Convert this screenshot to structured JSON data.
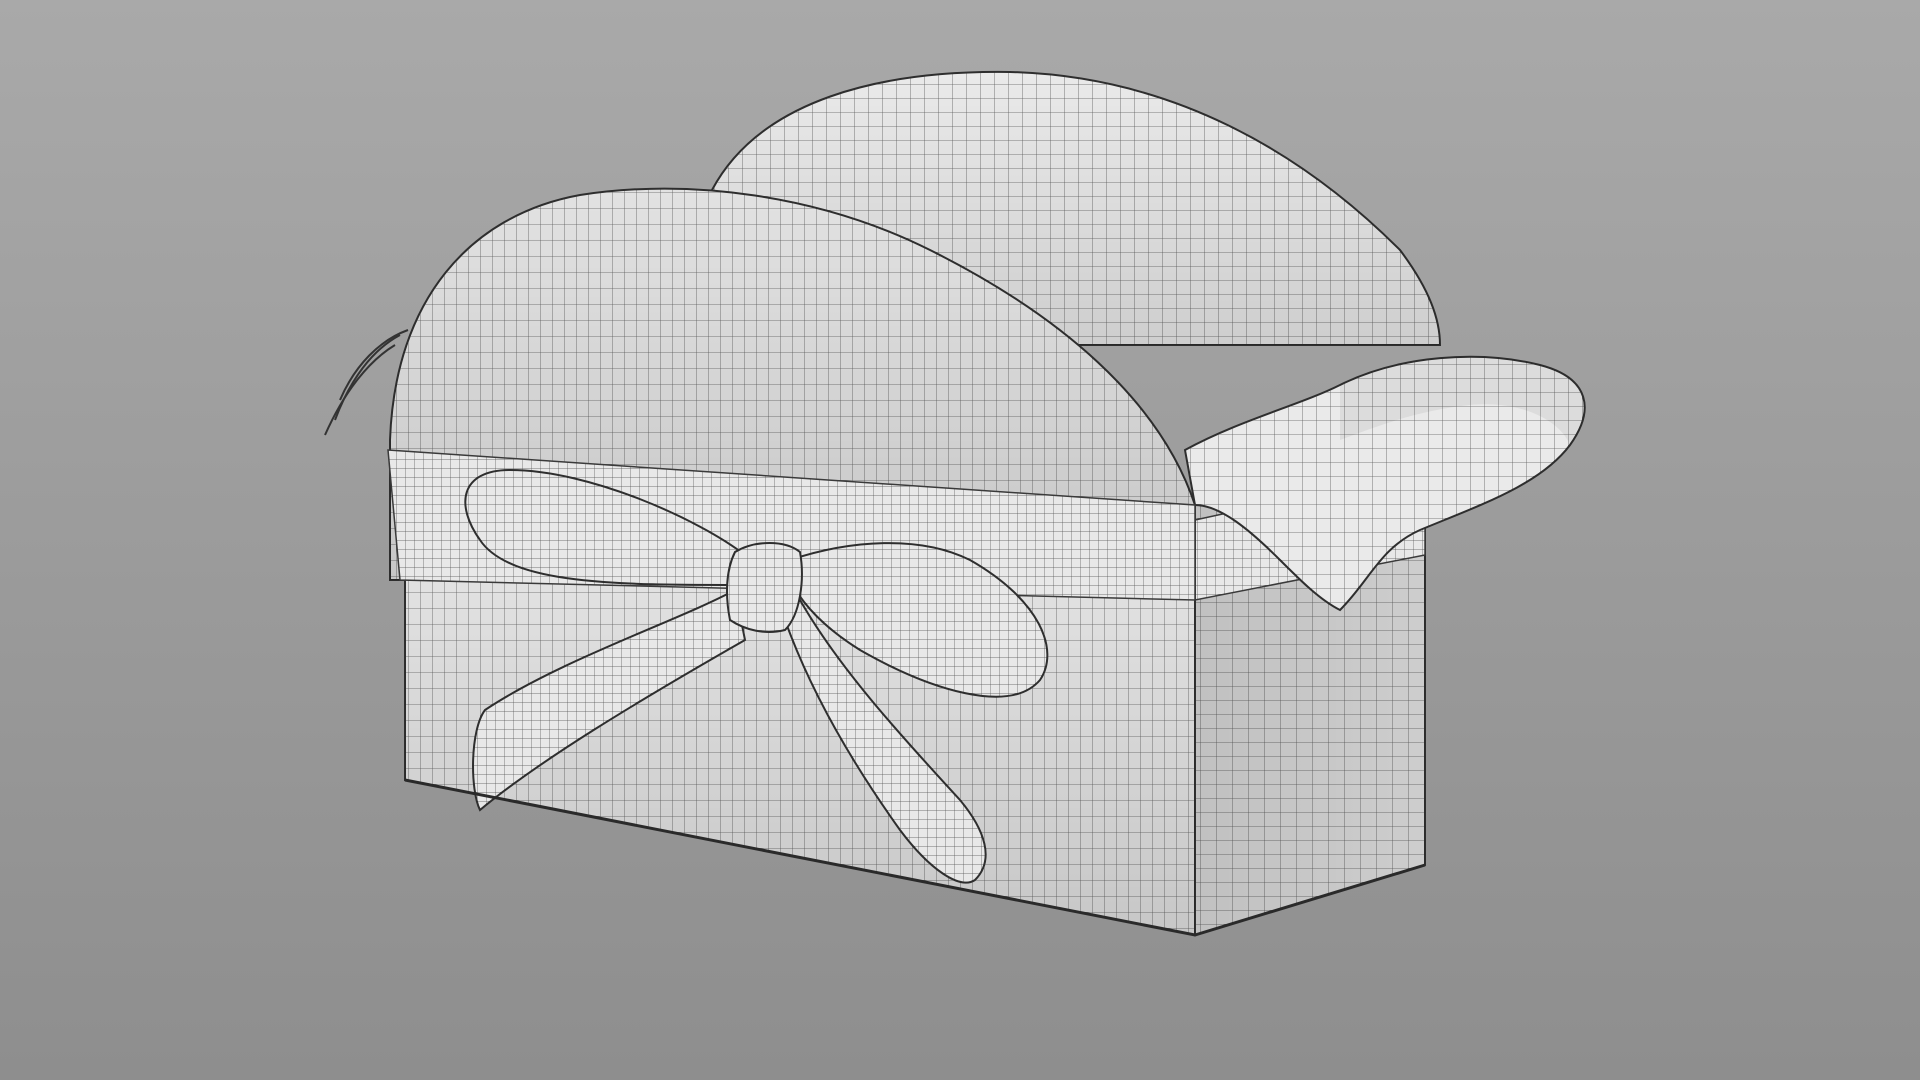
{
  "scene": {
    "subject": "wireframe-gift-box-with-ribbon-bow",
    "background_top": "#a9a9a9",
    "background_bottom": "#8e8e8e",
    "surface": "#eaeaea",
    "surface_shadow": "#c9c9c9",
    "wire": "#4a4a4a",
    "edge": "#2e2e2e"
  }
}
